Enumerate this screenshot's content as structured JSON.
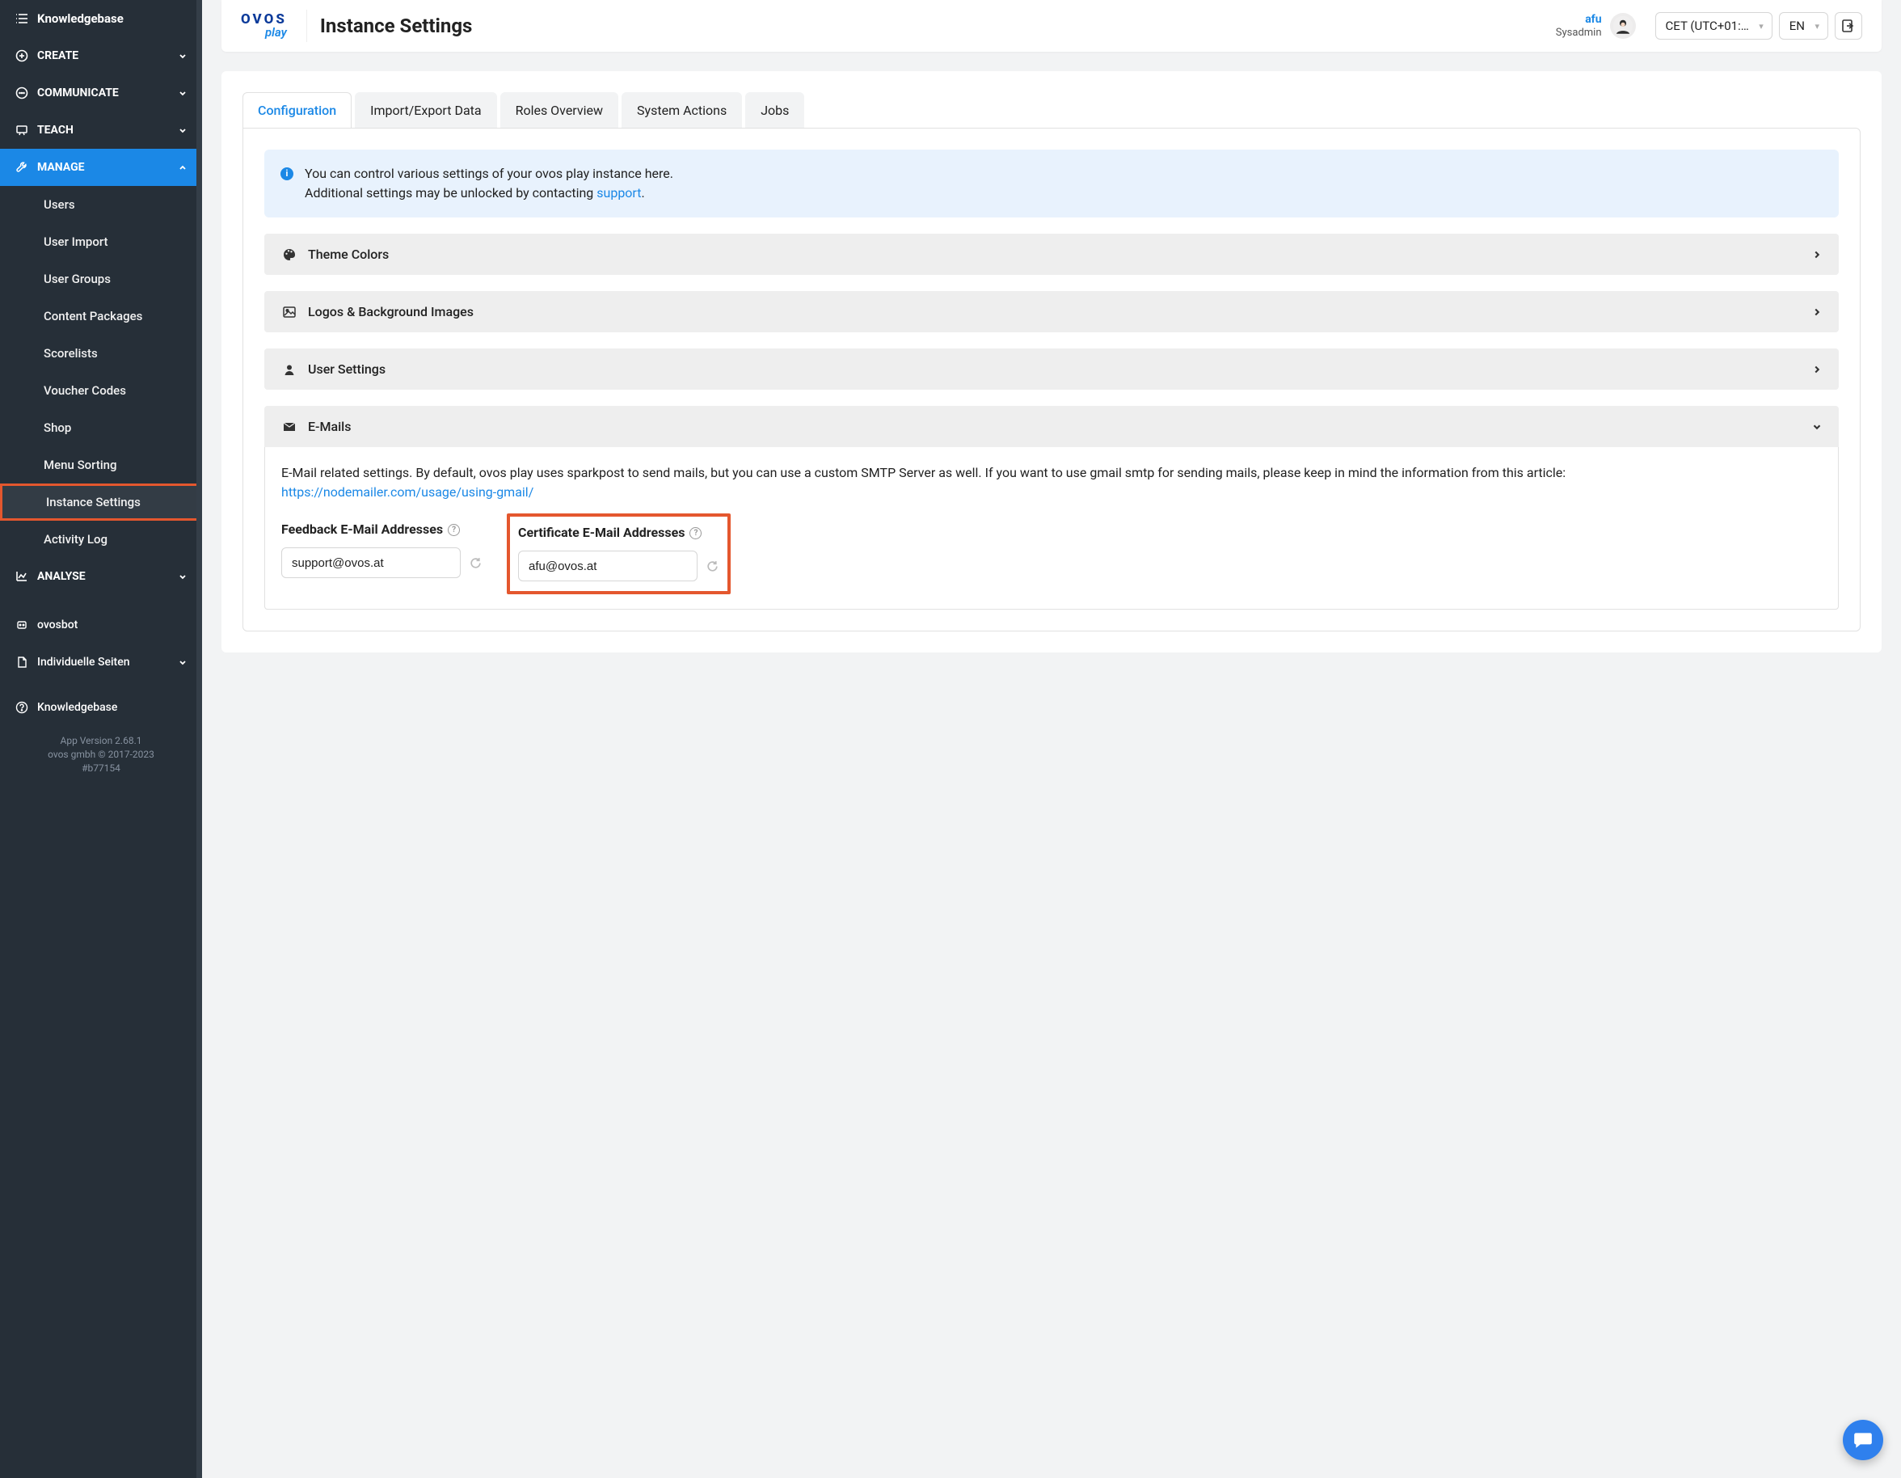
{
  "sidebar": {
    "top_label": "Knowledgebase",
    "sections": [
      {
        "label": "CREATE"
      },
      {
        "label": "COMMUNICATE"
      },
      {
        "label": "TEACH"
      },
      {
        "label": "MANAGE"
      },
      {
        "label": "ANALYSE"
      }
    ],
    "manage_items": [
      "Users",
      "User Import",
      "User Groups",
      "Content Packages",
      "Scorelists",
      "Voucher Codes",
      "Shop",
      "Menu Sorting",
      "Instance Settings",
      "Activity Log"
    ],
    "bottom_items": [
      "ovosbot",
      "Individuelle Seiten",
      "Knowledgebase"
    ],
    "footer": {
      "version": "App Version 2.68.1",
      "copyright": "ovos gmbh © 2017-2023",
      "build": "#b77154"
    }
  },
  "header": {
    "logo_top": "OVOS",
    "logo_bottom": "play",
    "page_title": "Instance Settings",
    "user_name": "afu",
    "user_role": "Sysadmin",
    "timezone": "CET (UTC+01:…",
    "language": "EN"
  },
  "tabs": [
    "Configuration",
    "Import/Export Data",
    "Roles Overview",
    "System Actions",
    "Jobs"
  ],
  "info": {
    "line1": "You can control various settings of your ovos play instance here.",
    "line2_pre": "Additional settings may be unlocked by contacting ",
    "support_label": "support",
    "line2_post": "."
  },
  "accordions": {
    "theme": "Theme Colors",
    "logos": "Logos & Background Images",
    "user_settings": "User Settings",
    "emails": "E-Mails"
  },
  "emails": {
    "description": "E-Mail related settings. By default, ovos play uses sparkpost to send mails, but you can use a custom SMTP Server as well. If you want to use gmail smtp for sending mails, please keep in mind the information from this article:",
    "link": "https://nodemailer.com/usage/using-gmail/",
    "feedback_label": "Feedback E-Mail Addresses",
    "feedback_value": "support@ovos.at",
    "certificate_label": "Certificate E-Mail Addresses",
    "certificate_value": "afu@ovos.at"
  }
}
